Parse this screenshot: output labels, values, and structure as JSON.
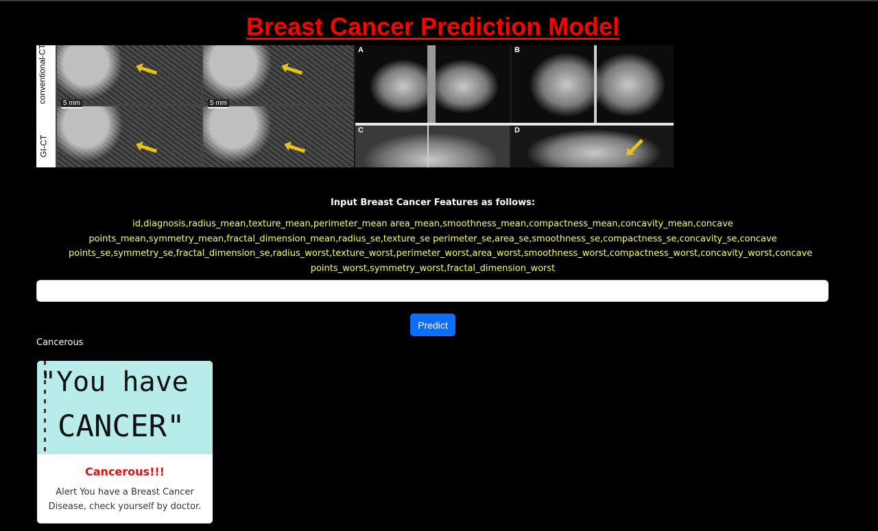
{
  "page": {
    "title": "Breast Cancer Prediction Model"
  },
  "images": {
    "ct_axis_top": "conventional-CT e",
    "ct_axis_bottom": "GI-CT",
    "scale_label": "5 mm",
    "panel_labels": [
      "A",
      "B",
      "C",
      "D"
    ]
  },
  "form": {
    "heading": "Input Breast Cancer Features as follows:",
    "features_text": "id,diagnosis,radius_mean,texture_mean,perimeter_mean area_mean,smoothness_mean,compactness_mean,concavity_mean,concave points_mean,symmetry_mean,fractal_dimension_mean,radius_se,texture_se perimeter_se,area_se,smoothness_se,compactness_se,concavity_se,concave points_se,symmetry_se,fractal_dimension_se,radius_worst,texture_worst,perimeter_worst,area_worst,smoothness_worst,compactness_worst,concavity_worst,concave points_worst,symmetry_worst,fractal_dimension_worst",
    "input_value": "",
    "predict_label": "Predict"
  },
  "result": {
    "text": "Cancerous",
    "card_image_line1": "\"You have",
    "card_image_line2": "CANCER\"",
    "card_title": "Cancerous!!!",
    "card_body": "Alert You have a Breast Cancer Disease, check yourself by doctor."
  },
  "colors": {
    "title": "#ff0000",
    "features": "#ffff66",
    "button": "#0d6efd",
    "card_title": "#dd1111",
    "card_image_bg": "#b8ecea"
  }
}
